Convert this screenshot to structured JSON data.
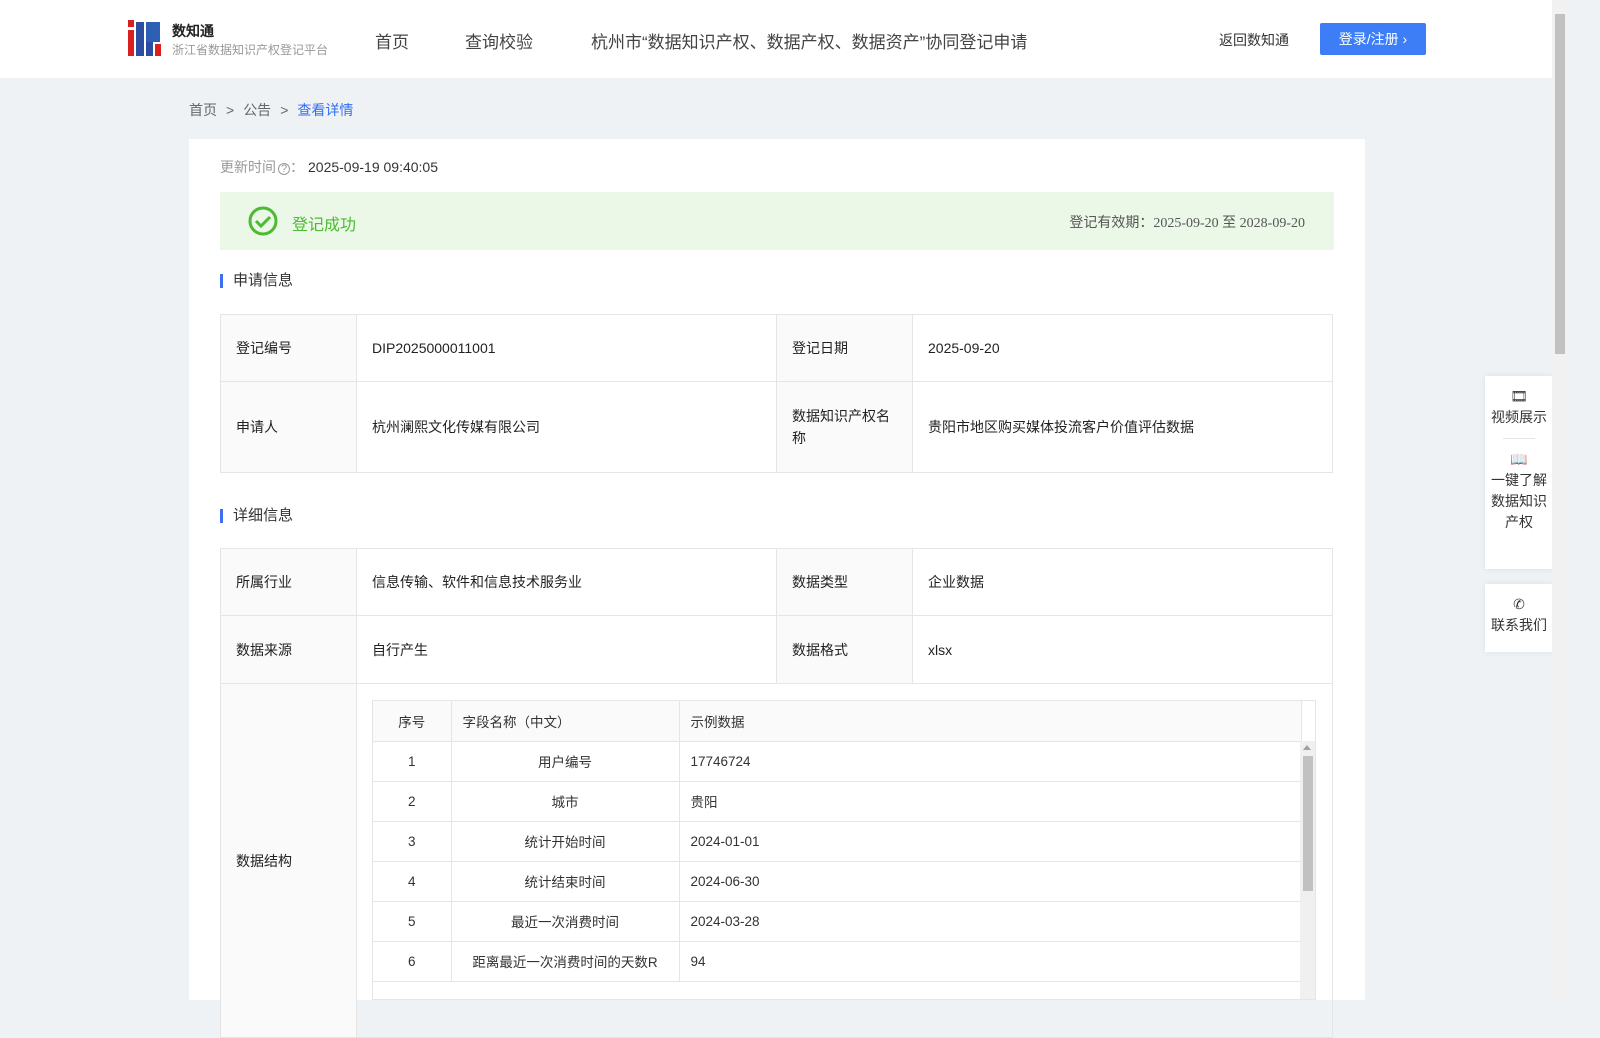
{
  "header": {
    "brand": "数知通",
    "subtitle": "浙江省数据知识产权登记平台",
    "nav": [
      "首页",
      "查询校验",
      "杭州市“数据知识产权、数据产权、数据资产”协同登记申请"
    ],
    "back": "返回数知通",
    "login": "登录/注册"
  },
  "breadcrumb": [
    "首页",
    "公告",
    "查看详情"
  ],
  "update": {
    "label": "更新时间",
    "value": "2025-09-19 09:40:05"
  },
  "status": {
    "text": "登记成功",
    "validity_label": "登记有效期：",
    "start": "2025-09-20",
    "to": "至",
    "end": "2028-09-20",
    "color": "#4cba33"
  },
  "apply": {
    "title": "申请信息",
    "rows": [
      [
        "登记编号",
        "DIP2025000011001",
        "登记日期",
        "2025-09-20"
      ],
      [
        "申请人",
        "杭州澜熙文化传媒有限公司",
        "数据知识产权名称",
        "贵阳市地区购买媒体投流客户价值评估数据"
      ]
    ]
  },
  "detail": {
    "title": "详细信息",
    "rows": [
      [
        "所属行业",
        "信息传输、软件和信息技术服务业",
        "数据类型",
        "企业数据"
      ],
      [
        "数据来源",
        "自行产生",
        "数据格式",
        "xlsx"
      ]
    ],
    "structure_label": "数据结构",
    "columns": [
      "序号",
      "字段名称（中文）",
      "示例数据"
    ],
    "fields": [
      [
        "1",
        "用户编号",
        "17746724"
      ],
      [
        "2",
        "城市",
        "贵阳"
      ],
      [
        "3",
        "统计开始时间",
        "2024-01-01"
      ],
      [
        "4",
        "统计结束时间",
        "2024-06-30"
      ],
      [
        "5",
        "最近一次消费时间",
        "2024-03-28"
      ],
      [
        "6",
        "距离最近一次消费时间的天数R",
        "94"
      ]
    ]
  },
  "float": {
    "video": "视频展示",
    "learn": "一键了解数据知识产权",
    "contact": "联系我们"
  }
}
